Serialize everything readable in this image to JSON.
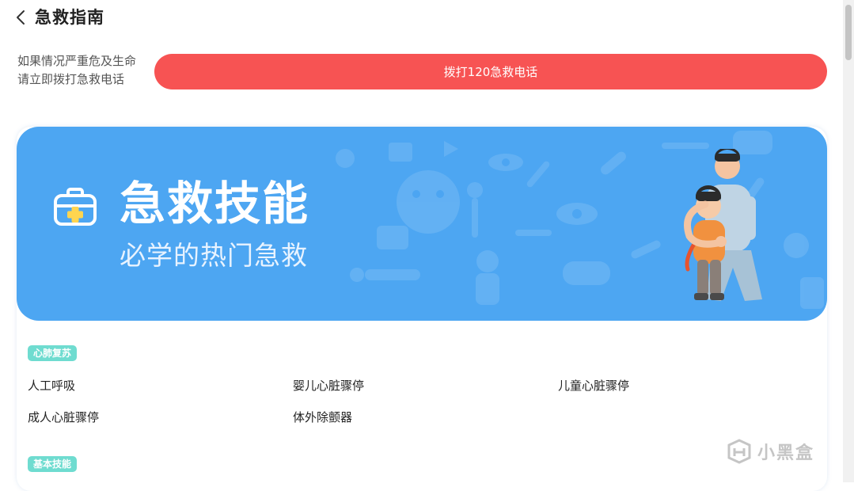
{
  "header": {
    "title": "急救指南"
  },
  "emergency": {
    "line1": "如果情况严重危及生命",
    "line2": "请立即拨打急救电话",
    "call_button": "拨打120急救电话"
  },
  "banner": {
    "title": "急救技能",
    "subtitle": "必学的热门急救",
    "icon": "first-aid-kit-icon"
  },
  "sections": [
    {
      "tag": "心肺复苏",
      "items": [
        "人工呼吸",
        "婴儿心脏骤停",
        "儿童心脏骤停",
        "成人心脏骤停",
        "体外除颤器"
      ]
    },
    {
      "tag": "基本技能",
      "items": []
    }
  ],
  "watermark": {
    "text": "小黑盒",
    "icon": "heybox-logo-icon"
  },
  "colors": {
    "call_button": "#f75353",
    "banner": "#4da6f2",
    "tag": "#6fdcd0"
  }
}
